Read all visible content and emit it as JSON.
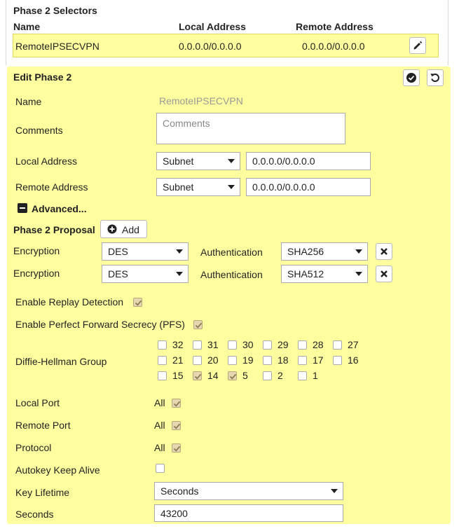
{
  "selectors": {
    "title": "Phase 2 Selectors",
    "columns": [
      "Name",
      "Local Address",
      "Remote Address"
    ],
    "row": {
      "name": "RemoteIPSECVPN",
      "local": "0.0.0.0/0.0.0.0",
      "remote": "0.0.0.0/0.0.0.0"
    }
  },
  "edit": {
    "title": "Edit Phase 2",
    "name_label": "Name",
    "name_value": "RemoteIPSECVPN",
    "comments_label": "Comments",
    "comments_placeholder": "Comments",
    "local_label": "Local Address",
    "local_type": "Subnet",
    "local_value": "0.0.0.0/0.0.0.0",
    "remote_label": "Remote Address",
    "remote_type": "Subnet",
    "remote_value": "0.0.0.0/0.0.0.0",
    "advanced_label": "Advanced..."
  },
  "proposal": {
    "label": "Phase 2 Proposal",
    "add_label": "Add",
    "rows": [
      {
        "enc_label": "Encryption",
        "enc": "DES",
        "auth_label": "Authentication",
        "auth": "SHA256"
      },
      {
        "enc_label": "Encryption",
        "enc": "DES",
        "auth_label": "Authentication",
        "auth": "SHA512"
      }
    ]
  },
  "options": {
    "replay_label": "Enable Replay Detection",
    "replay_checked": true,
    "pfs_label": "Enable Perfect Forward Secrecy (PFS)",
    "pfs_checked": true,
    "dh_label": "Diffie-Hellman Group",
    "dh_groups": [
      {
        "n": "32",
        "checked": false
      },
      {
        "n": "31",
        "checked": false
      },
      {
        "n": "30",
        "checked": false
      },
      {
        "n": "29",
        "checked": false
      },
      {
        "n": "28",
        "checked": false
      },
      {
        "n": "27",
        "checked": false
      },
      {
        "n": "21",
        "checked": false
      },
      {
        "n": "20",
        "checked": false
      },
      {
        "n": "19",
        "checked": false
      },
      {
        "n": "18",
        "checked": false
      },
      {
        "n": "17",
        "checked": false
      },
      {
        "n": "16",
        "checked": false
      },
      {
        "n": "15",
        "checked": false
      },
      {
        "n": "14",
        "checked": true
      },
      {
        "n": "5",
        "checked": true
      },
      {
        "n": "2",
        "checked": false
      },
      {
        "n": "1",
        "checked": false
      }
    ],
    "local_port_label": "Local Port",
    "local_port_value": "All",
    "remote_port_label": "Remote Port",
    "remote_port_value": "All",
    "protocol_label": "Protocol",
    "protocol_value": "All",
    "autokey_label": "Autokey Keep Alive",
    "autokey_checked": false,
    "lifetime_label": "Key Lifetime",
    "lifetime_value": "Seconds",
    "seconds_label": "Seconds",
    "seconds_value": "43200"
  },
  "colors": {
    "panel": "#ffffa0",
    "checked": "#e6d7b0"
  }
}
